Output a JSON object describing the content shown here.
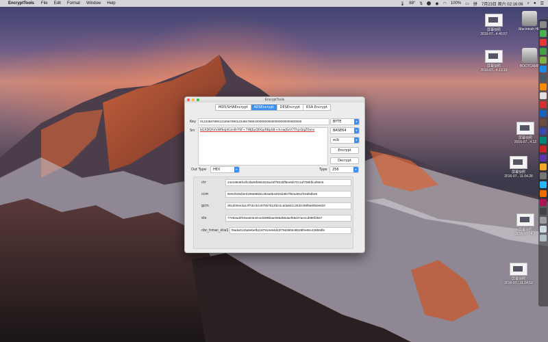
{
  "menubar": {
    "app_name": "EncryptTools",
    "menus": [
      "File",
      "Edit",
      "Format",
      "Window",
      "Help"
    ],
    "temperature": "88°",
    "battery": "100%",
    "datetime": "7月23日 周六  02:16:06"
  },
  "desktop": {
    "icons": [
      {
        "name": "屏幕快照",
        "sub": "2016-07...4.40.57"
      },
      {
        "name": "Macintosh HD",
        "sub": ""
      },
      {
        "name": "屏幕快照",
        "sub": "2016-07...4.13.19"
      },
      {
        "name": "BOOTCAMP",
        "sub": ""
      },
      {
        "name": "屏幕快照",
        "sub": "2016-07...4.12"
      },
      {
        "name": "屏幕快照",
        "sub": "2016-07...11.04.28"
      },
      {
        "name": "屏幕快照",
        "sub": "2016-07...4.2"
      },
      {
        "name": "屏幕快照",
        "sub": "2016-07...11.04.52"
      }
    ]
  },
  "window": {
    "title": "EncryptTools",
    "tabs": [
      "MD5/SHAEncrypt",
      "AESEncrypt",
      "DESEncrypt",
      "RSA Encrypt"
    ],
    "active_tab": "AESEncrypt",
    "key_label": "Key",
    "key_value": "0123456789012345678901234567890100000000000000000000000000",
    "src_label": "Src",
    "src_value": "bGXDQhVxWfbsJdGzs8rYSF+7WJEpQ0GpRBpS8+rknwJSsV7ThjsQqZ0ans",
    "key_format": "BYTE",
    "src_format": "BASE64",
    "mode": "ecb",
    "encrypt_label": "Encrypt",
    "decrypt_label": "Decrypt",
    "out_type_label": "Out Type",
    "out_type": "HEX",
    "type_label": "Type",
    "type_value": "256",
    "results": [
      {
        "label": "ctr",
        "value": "24e19946fcdfc3fa06f46543c6a34f7801bff5ee6b70c1af708fdfcaf92e5"
      },
      {
        "label": "ccm",
        "value": "9e9cf646d2e0198a96b51354a6b44831b6b7f82a49e2fc8d6dbe6"
      },
      {
        "label": "gcm",
        "value": "d61d00ee2a13f7dccb1c875b7613fd41cdda841c2632c58f6a80bde820"
      },
      {
        "label": "xts",
        "value": "77e82ad0fc6ea64540ced399bbae065d58daef58d47ae4cd980f2567"
      },
      {
        "label": "cbc_hmac_sha1",
        "value": "f9ada0143a9ebefb1187914e94d42f79d35b548b28f0e66c428b8dfe"
      }
    ]
  }
}
